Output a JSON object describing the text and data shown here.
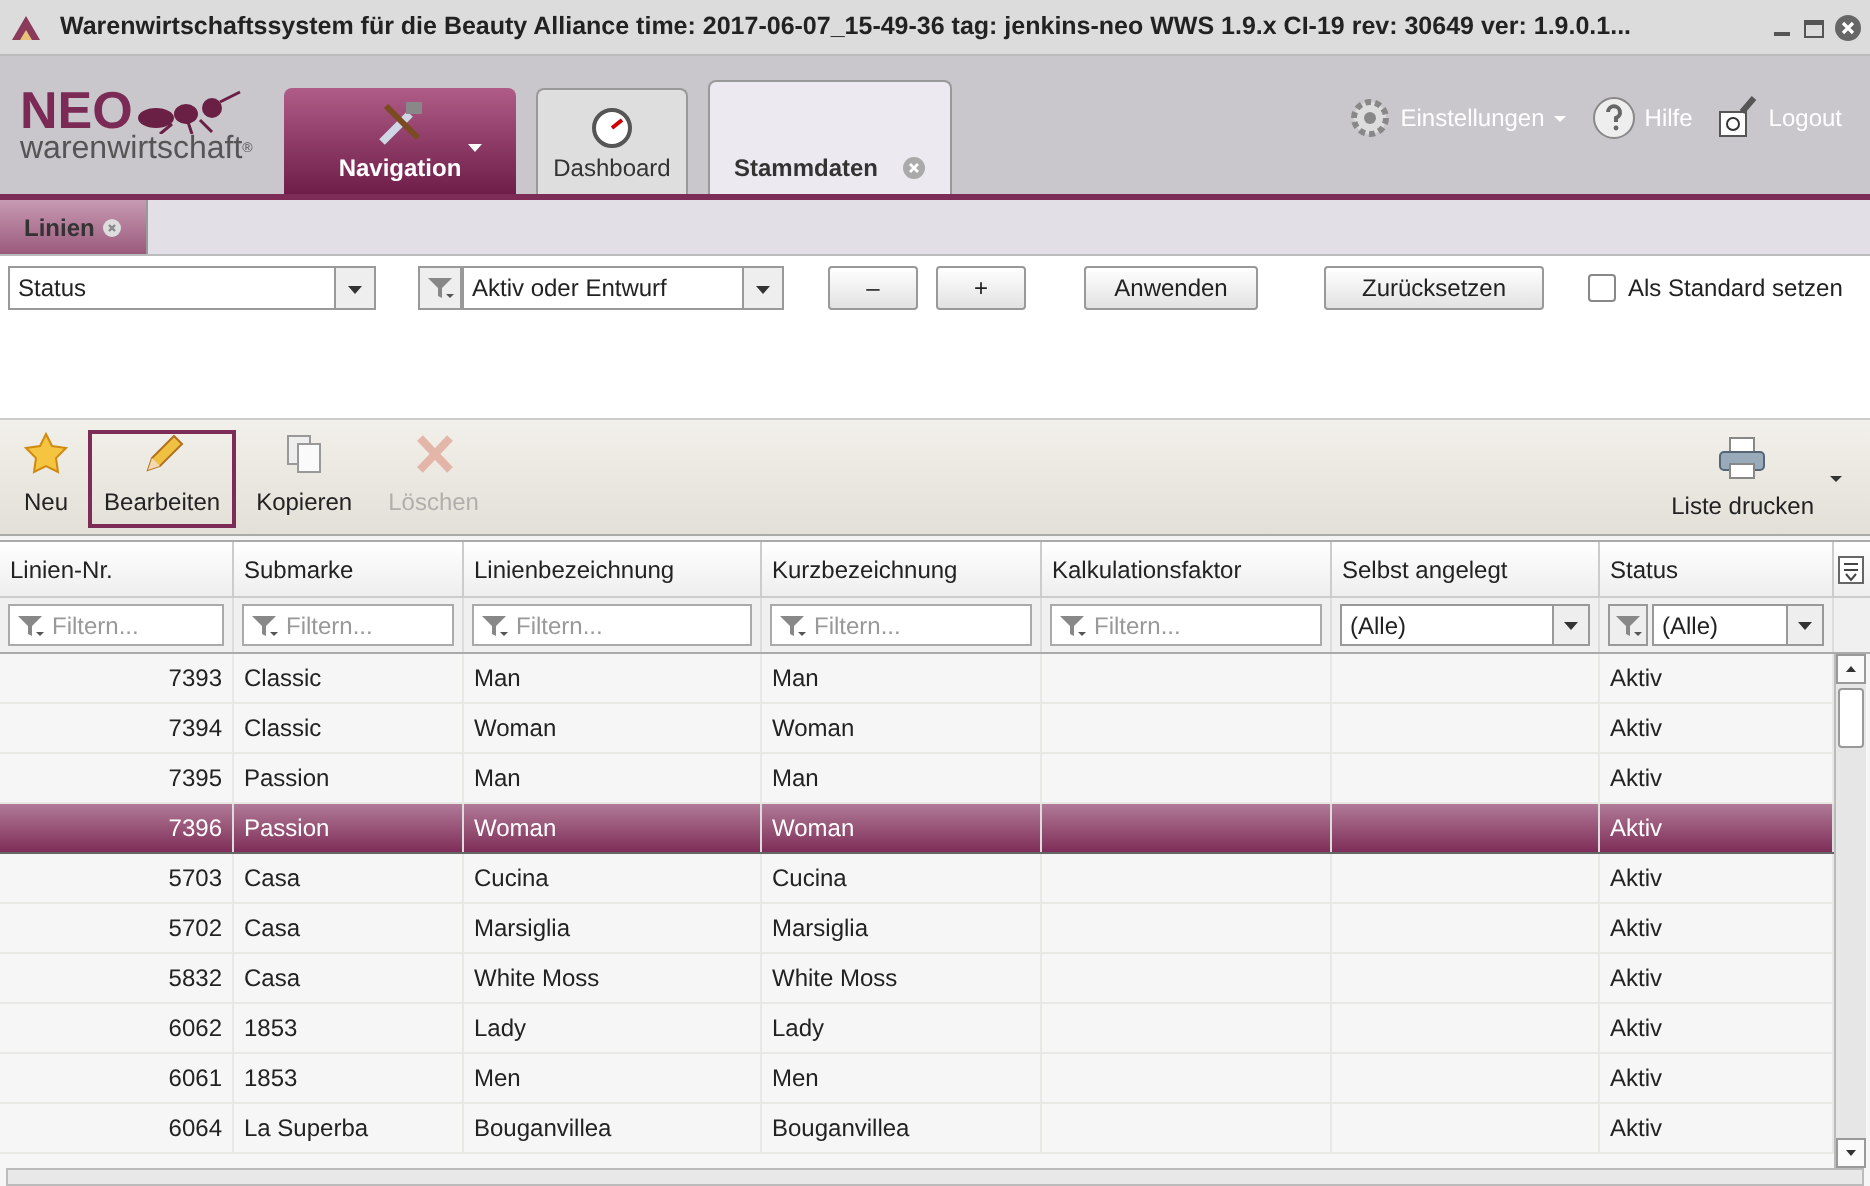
{
  "window": {
    "title": "Warenwirtschaftssystem für die Beauty Alliance time: 2017-06-07_15-49-36 tag: jenkins-neo WWS 1.9.x CI-19 rev: 30649 ver: 1.9.0.1..."
  },
  "logo": {
    "top": "NEO",
    "bottom_prefix": "waren",
    "bottom_suffix": "wirtschaft",
    "mark": "®"
  },
  "main_tabs": [
    {
      "label": "Navigation",
      "kind": "menu",
      "selected": false
    },
    {
      "label": "Dashboard",
      "kind": "icon",
      "selected": false
    },
    {
      "label": "Stammdaten",
      "kind": "closable",
      "selected": true
    }
  ],
  "header_links": [
    {
      "label": "Einstellungen",
      "kind": "settings"
    },
    {
      "label": "Hilfe",
      "kind": "help"
    },
    {
      "label": "Logout",
      "kind": "logout"
    }
  ],
  "sub_tabs": [
    {
      "label": "Linien",
      "selected": true
    }
  ],
  "filter": {
    "field": "Status",
    "value": "Aktiv oder Entwurf",
    "minus": "–",
    "plus": "+",
    "apply": "Anwenden",
    "reset": "Zurücksetzen",
    "default_label": "Als Standard setzen",
    "default_checked": false
  },
  "toolbar": [
    {
      "label": "Neu",
      "kind": "new",
      "selected": false,
      "disabled": false
    },
    {
      "label": "Bearbeiten",
      "kind": "edit",
      "selected": true,
      "disabled": false
    },
    {
      "label": "Kopieren",
      "kind": "copy",
      "selected": false,
      "disabled": false
    },
    {
      "label": "Löschen",
      "kind": "delete",
      "selected": false,
      "disabled": true
    }
  ],
  "print_button": "Liste drucken",
  "table": {
    "columns": [
      {
        "label": "Linien-Nr.",
        "kind": "text",
        "placeholder": "Filtern..."
      },
      {
        "label": "Submarke",
        "kind": "text",
        "placeholder": "Filtern..."
      },
      {
        "label": "Linienbezeichnung",
        "kind": "text",
        "placeholder": "Filtern..."
      },
      {
        "label": "Kurzbezeichnung",
        "kind": "text",
        "placeholder": "Filtern..."
      },
      {
        "label": "Kalkulationsfaktor",
        "kind": "text",
        "placeholder": "Filtern..."
      },
      {
        "label": "Selbst angelegt",
        "kind": "select",
        "value": "(Alle)"
      },
      {
        "label": "Status",
        "kind": "select_funnel",
        "value": "(Alle)"
      }
    ],
    "rows": [
      {
        "cells": [
          "7393",
          "Classic",
          "Man",
          "Man",
          "",
          "",
          "Aktiv"
        ],
        "selected": false
      },
      {
        "cells": [
          "7394",
          "Classic",
          "Woman",
          "Woman",
          "",
          "",
          "Aktiv"
        ],
        "selected": false
      },
      {
        "cells": [
          "7395",
          "Passion",
          "Man",
          "Man",
          "",
          "",
          "Aktiv"
        ],
        "selected": false
      },
      {
        "cells": [
          "7396",
          "Passion",
          "Woman",
          "Woman",
          "",
          "",
          "Aktiv"
        ],
        "selected": true
      },
      {
        "cells": [
          "5703",
          "Casa",
          "Cucina",
          "Cucina",
          "",
          "",
          "Aktiv"
        ],
        "selected": false
      },
      {
        "cells": [
          "5702",
          "Casa",
          "Marsiglia",
          "Marsiglia",
          "",
          "",
          "Aktiv"
        ],
        "selected": false
      },
      {
        "cells": [
          "5832",
          "Casa",
          "White Moss",
          "White Moss",
          "",
          "",
          "Aktiv"
        ],
        "selected": false
      },
      {
        "cells": [
          "6062",
          "1853",
          "Lady",
          "Lady",
          "",
          "",
          "Aktiv"
        ],
        "selected": false
      },
      {
        "cells": [
          "6061",
          "1853",
          "Men",
          "Men",
          "",
          "",
          "Aktiv"
        ],
        "selected": false
      },
      {
        "cells": [
          "6064",
          "La Superba",
          "Bouganvillea",
          "Bouganvillea",
          "",
          "",
          "Aktiv"
        ],
        "selected": false
      }
    ]
  }
}
